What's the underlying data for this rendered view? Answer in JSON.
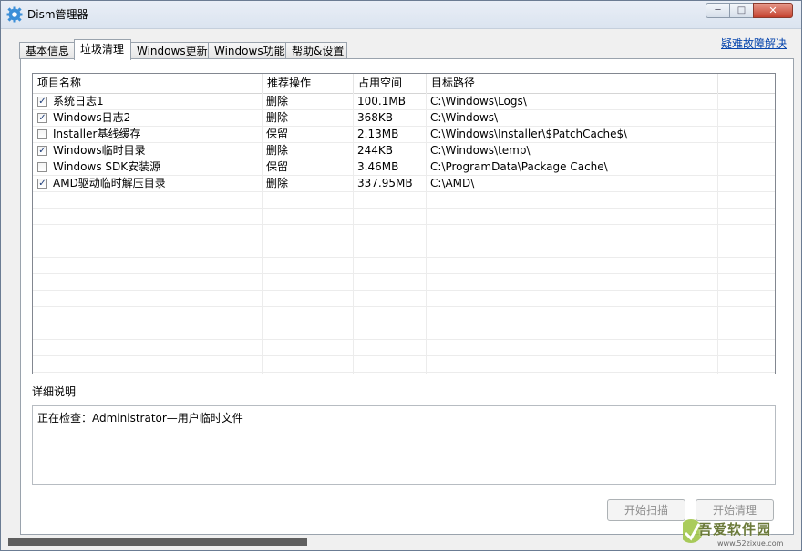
{
  "window": {
    "title": "Dism管理器",
    "min_glyph": "─",
    "max_glyph": "□",
    "close_glyph": "✕"
  },
  "tabs": [
    {
      "label": "基本信息"
    },
    {
      "label": "垃圾清理"
    },
    {
      "label": "Windows更新"
    },
    {
      "label": "Windows功能"
    },
    {
      "label": "帮助&设置"
    }
  ],
  "active_tab": "垃圾清理",
  "help_link": "疑难故障解决",
  "list": {
    "headers": [
      "项目名称",
      "推荐操作",
      "占用空间",
      "目标路径"
    ],
    "rows": [
      {
        "checked": true,
        "name": "系统日志1",
        "action": "删除",
        "size": "100.1MB",
        "path": "C:\\Windows\\Logs\\"
      },
      {
        "checked": true,
        "name": "Windows日志2",
        "action": "删除",
        "size": "368KB",
        "path": "C:\\Windows\\"
      },
      {
        "checked": false,
        "name": "Installer基线缓存",
        "action": "保留",
        "size": "2.13MB",
        "path": "C:\\Windows\\Installer\\$PatchCache$\\"
      },
      {
        "checked": true,
        "name": "Windows临时目录",
        "action": "删除",
        "size": "244KB",
        "path": "C:\\Windows\\temp\\"
      },
      {
        "checked": false,
        "name": "Windows SDK安装源",
        "action": "保留",
        "size": "3.46MB",
        "path": "C:\\ProgramData\\Package Cache\\"
      },
      {
        "checked": true,
        "name": "AMD驱动临时解压目录",
        "action": "删除",
        "size": "337.95MB",
        "path": "C:\\AMD\\"
      }
    ]
  },
  "detail": {
    "label": "详细说明",
    "text": "正在检查：Administrator—用户临时文件"
  },
  "buttons": {
    "scan": "开始扫描",
    "clean": "开始清理"
  },
  "progress": 0.38,
  "watermark": {
    "text": "吾爱软件园",
    "url": "www.52zixue.com"
  },
  "colors": {
    "link": "#0645ad",
    "progress_fill": "#5f5f5f",
    "close_button": "#c4412e"
  }
}
